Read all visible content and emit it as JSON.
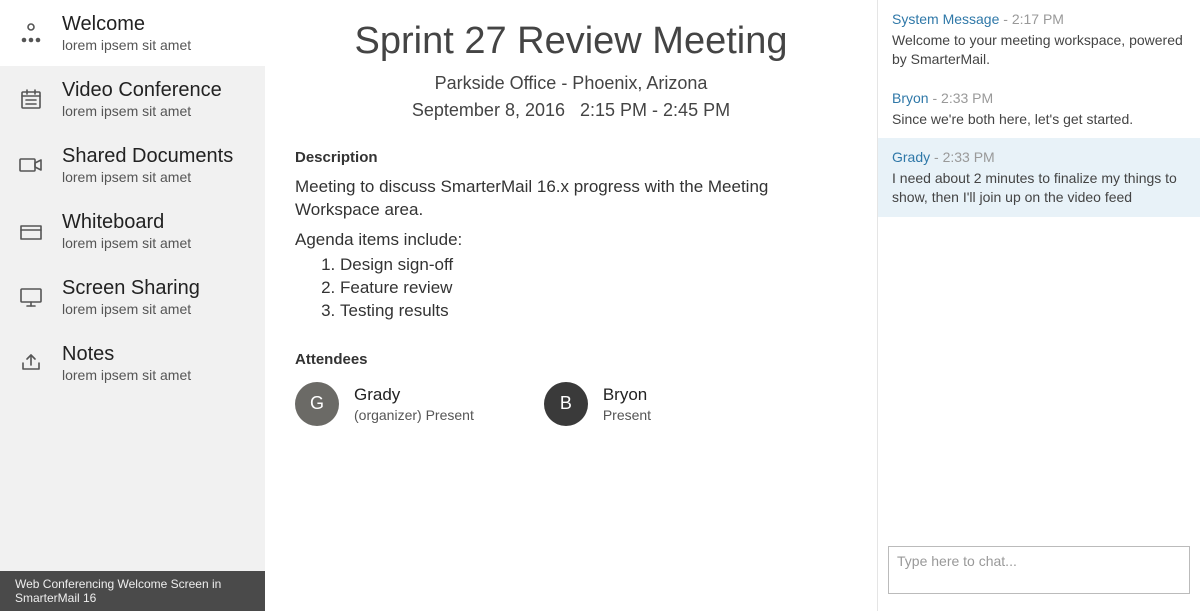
{
  "sidebar": {
    "items": [
      {
        "title": "Welcome",
        "subtitle": "lorem ipsem sit amet",
        "icon": "hierarchy"
      },
      {
        "title": "Video Conference",
        "subtitle": "lorem ipsem sit amet",
        "icon": "calendar"
      },
      {
        "title": "Shared Documents",
        "subtitle": "lorem ipsem sit amet",
        "icon": "video-camera"
      },
      {
        "title": "Whiteboard",
        "subtitle": "lorem ipsem sit amet",
        "icon": "folder"
      },
      {
        "title": "Screen Sharing",
        "subtitle": "lorem ipsem sit amet",
        "icon": "monitor"
      },
      {
        "title": "Notes",
        "subtitle": "lorem ipsem sit amet",
        "icon": "share"
      }
    ],
    "active_index": 0,
    "caption": "Web Conferencing Welcome Screen in SmarterMail 16"
  },
  "meeting": {
    "title": "Sprint 27 Review Meeting",
    "location": "Parkside Office - Phoenix, Arizona",
    "date": "September 8, 2016",
    "time": "2:15 PM - 2:45 PM",
    "description_heading": "Description",
    "description": "Meeting to discuss SmarterMail 16.x progress with the Meeting Workspace area.",
    "agenda_label": "Agenda items include:",
    "agenda": [
      "Design sign-off",
      "Feature review",
      "Testing results"
    ],
    "attendees_heading": "Attendees",
    "attendees": [
      {
        "name": "Grady",
        "status": "(organizer) Present",
        "initial": "G",
        "avatar_bg": "#6b6a66"
      },
      {
        "name": "Bryon",
        "status": "Present",
        "initial": "B",
        "avatar_bg": "#3a3a3a"
      }
    ]
  },
  "chat": {
    "messages": [
      {
        "sender": "System Message",
        "time": "2:17 PM",
        "body": "Welcome to your meeting workspace, powered by SmarterMail.",
        "highlight": false
      },
      {
        "sender": "Bryon",
        "time": "2:33 PM",
        "body": "Since we're both here, let's get started.",
        "highlight": false
      },
      {
        "sender": "Grady",
        "time": "2:33 PM",
        "body": "I need about 2 minutes to finalize my things to show, then I'll join up on the video feed",
        "highlight": true
      }
    ],
    "input_placeholder": "Type here to chat..."
  }
}
